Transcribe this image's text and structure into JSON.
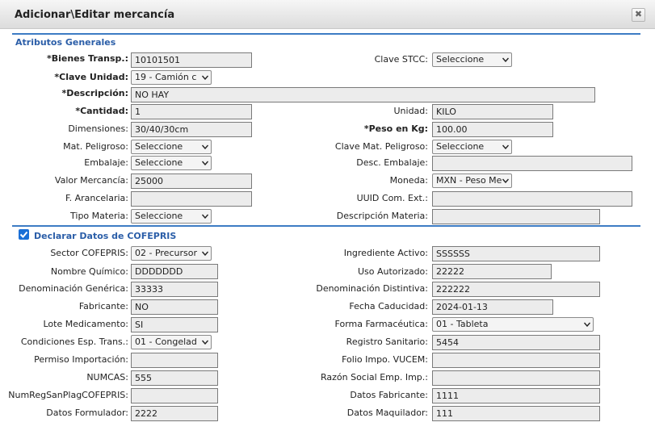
{
  "dialog": {
    "title": "Adicionar\\Editar mercancía",
    "close_glyph": "✖"
  },
  "sections": {
    "general": "Atributos Generales",
    "cofepris": "Declarar Datos de COFEPRIS",
    "cofepris_checked": true
  },
  "general": {
    "bienes_transp": {
      "label": "*Bienes Transp.:",
      "value": "10101501"
    },
    "clave_stcc": {
      "label": "Clave STCC:",
      "value": "Seleccione"
    },
    "clave_unidad": {
      "label": "*Clave Unidad:",
      "value": "19 - Camión c"
    },
    "descripcion": {
      "label": "*Descripción:",
      "value": "NO HAY"
    },
    "cantidad": {
      "label": "*Cantidad:",
      "value": "1"
    },
    "unidad": {
      "label": "Unidad:",
      "value": "KILO"
    },
    "dimensiones": {
      "label": "Dimensiones:",
      "value": "30/40/30cm"
    },
    "peso_kg": {
      "label": "*Peso en Kg:",
      "value": "100.00"
    },
    "mat_peligroso": {
      "label": "Mat. Peligroso:",
      "value": "Seleccione"
    },
    "clave_mat_peligroso": {
      "label": "Clave Mat. Peligroso:",
      "value": "Seleccione"
    },
    "embalaje": {
      "label": "Embalaje:",
      "value": "Seleccione"
    },
    "desc_embalaje": {
      "label": "Desc. Embalaje:",
      "value": ""
    },
    "valor_mercancia": {
      "label": "Valor Mercancía:",
      "value": "25000"
    },
    "moneda": {
      "label": "Moneda:",
      "value": "MXN - Peso Me"
    },
    "f_arancelaria": {
      "label": "F. Arancelaria:",
      "value": ""
    },
    "uuid_com_ext": {
      "label": "UUID Com. Ext.:",
      "value": ""
    },
    "tipo_materia": {
      "label": "Tipo Materia:",
      "value": "Seleccione"
    },
    "descripcion_materia": {
      "label": "Descripción Materia:",
      "value": ""
    }
  },
  "cofepris": {
    "sector": {
      "label": "Sector COFEPRIS:",
      "value": "02 - Precursor"
    },
    "ingrediente_activo": {
      "label": "Ingrediente Activo:",
      "value": "SSSSSS"
    },
    "nombre_quimico": {
      "label": "Nombre Químico:",
      "value": "DDDDDDD"
    },
    "uso_autorizado": {
      "label": "Uso Autorizado:",
      "value": "22222"
    },
    "denominacion_generica": {
      "label": "Denominación Genérica:",
      "value": "33333"
    },
    "denominacion_distintiva": {
      "label": "Denominación Distintiva:",
      "value": "222222"
    },
    "fabricante": {
      "label": "Fabricante:",
      "value": "NO"
    },
    "fecha_caducidad": {
      "label": "Fecha Caducidad:",
      "value": "2024-01-13"
    },
    "lote_medicamento": {
      "label": "Lote Medicamento:",
      "value": "SI"
    },
    "forma_farmaceutica": {
      "label": "Forma Farmacéutica:",
      "value": "01 - Tableta"
    },
    "condiciones_esp_trans": {
      "label": "Condiciones Esp. Trans.:",
      "value": "01 - Congelad"
    },
    "registro_sanitario": {
      "label": "Registro Sanitario:",
      "value": "5454"
    },
    "permiso_importacion": {
      "label": "Permiso Importación:",
      "value": ""
    },
    "folio_impo_vucem": {
      "label": "Folio Impo. VUCEM:",
      "value": ""
    },
    "numcas": {
      "label": "NUMCAS:",
      "value": "555"
    },
    "razon_social_emp_imp": {
      "label": "Razón Social Emp. Imp.:",
      "value": ""
    },
    "num_reg_san_plag": {
      "label": "NumRegSanPlagCOFEPRIS:",
      "value": ""
    },
    "datos_fabricante": {
      "label": "Datos Fabricante:",
      "value": "1111"
    },
    "datos_formulador": {
      "label": "Datos Formulador:",
      "value": "2222"
    },
    "datos_maquilador": {
      "label": "Datos Maquilador:",
      "value": "111"
    }
  }
}
